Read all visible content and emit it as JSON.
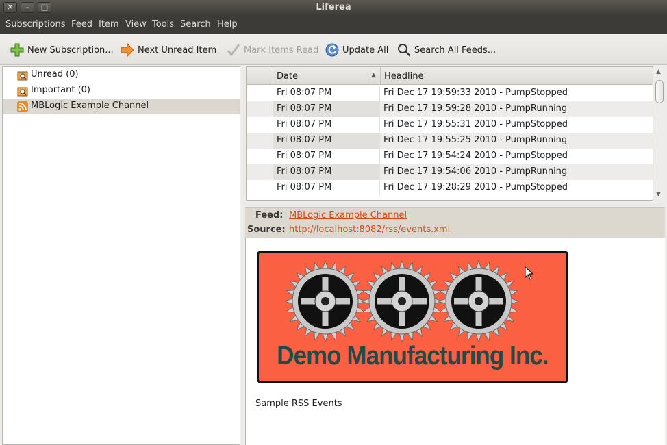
{
  "window": {
    "title": "Liferea"
  },
  "menu": [
    "Subscriptions",
    "Feed",
    "Item",
    "View",
    "Tools",
    "Search",
    "Help"
  ],
  "toolbar": {
    "new_subscription": "New Subscription...",
    "next_unread": "Next Unread Item",
    "mark_read": "Mark Items Read",
    "update_all": "Update All",
    "search_all": "Search All Feeds..."
  },
  "feeds": [
    {
      "label": "Unread (0)",
      "icon": "search-folder-icon"
    },
    {
      "label": "Important (0)",
      "icon": "search-folder-icon"
    },
    {
      "label": "MBLogic Example Channel",
      "icon": "rss-feed-icon",
      "selected": true
    }
  ],
  "itemlist": {
    "headers": {
      "date": "Date",
      "headline": "Headline"
    },
    "rows": [
      {
        "date": "Fri 08:07 PM",
        "headline": "Fri Dec 17 19:59:33 2010 - PumpStopped"
      },
      {
        "date": "Fri 08:07 PM",
        "headline": "Fri Dec 17 19:59:28 2010 - PumpRunning"
      },
      {
        "date": "Fri 08:07 PM",
        "headline": "Fri Dec 17 19:55:31 2010 - PumpStopped"
      },
      {
        "date": "Fri 08:07 PM",
        "headline": "Fri Dec 17 19:55:25 2010 - PumpRunning"
      },
      {
        "date": "Fri 08:07 PM",
        "headline": "Fri Dec 17 19:54:24 2010 - PumpStopped"
      },
      {
        "date": "Fri 08:07 PM",
        "headline": "Fri Dec 17 19:54:06 2010 - PumpRunning"
      },
      {
        "date": "Fri 08:07 PM",
        "headline": "Fri Dec 17 19:28:29 2010 - PumpStopped"
      }
    ]
  },
  "item_view": {
    "feed_label": "Feed:",
    "feed_value": "MBLogic Example Channel",
    "source_label": "Source:",
    "source_value": "http://localhost:8082/rss/events.xml",
    "banner_text": "Demo Manufacturing Inc.",
    "description": "Sample RSS Events"
  },
  "colors": {
    "accent_link": "#dd4814",
    "banner_background": "#fa6041",
    "banner_text": "#1f4c4a",
    "selection": "#dcd8d0"
  }
}
